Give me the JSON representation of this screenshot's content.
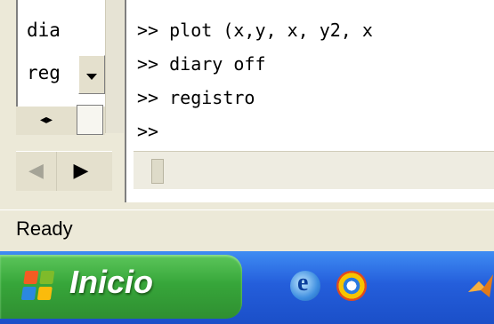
{
  "history": {
    "items": [
      "dia",
      "reg"
    ]
  },
  "command_window": {
    "lines": [
      ">> plot (x,y, x, y2, x",
      ">> diary off",
      ">> registro",
      ">>"
    ]
  },
  "status": {
    "text": "Ready"
  },
  "taskbar": {
    "start_label": "Inicio"
  },
  "icons": {
    "scroll_down": "chevron-down-icon",
    "split": "left-right-arrows-icon",
    "nav_left": "triangle-left-icon",
    "nav_right": "triangle-right-icon",
    "windows_logo": "windows-logo-icon",
    "ie": "internet-explorer-icon",
    "browser": "browser-icon",
    "matlab": "matlab-icon"
  },
  "colors": {
    "taskbar_blue": "#245edb",
    "start_green": "#37a63a",
    "window_bg": "#ece9d8"
  }
}
